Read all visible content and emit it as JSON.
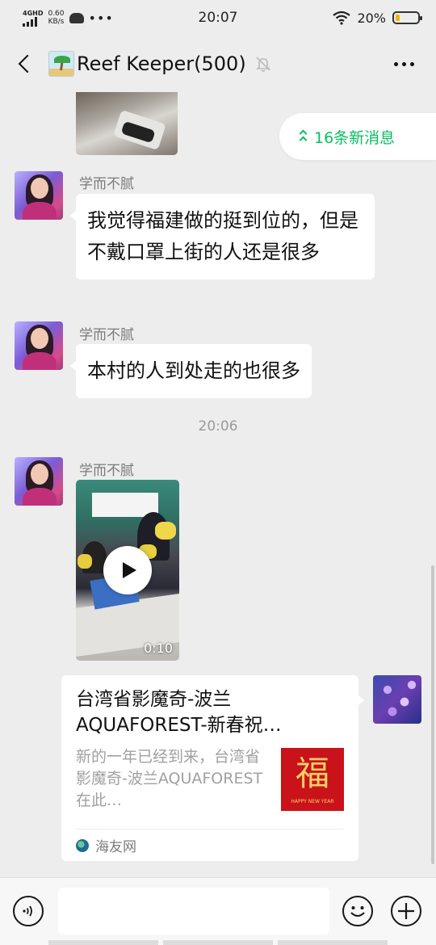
{
  "status_bar": {
    "network": "4GHD",
    "speed_value": "0.60",
    "speed_unit": "KB/s",
    "time": "20:07",
    "battery_percent": "20%",
    "battery_level": 0.2,
    "icons": [
      "signal-icon",
      "cloud-icon",
      "wifi-icon",
      "battery-icon"
    ]
  },
  "header": {
    "title": "Reef Keeper(500)",
    "icons": [
      "back-arrow-icon",
      "palm-island-icon",
      "muted-bell-icon",
      "more-dots-icon"
    ]
  },
  "new_messages": {
    "label": "16条新消息"
  },
  "messages": [
    {
      "type": "text",
      "sender": "学而不腻",
      "text": "我觉得福建做的挺到位的，但是不戴口罩上街的人还是很多"
    },
    {
      "type": "text",
      "sender": "学而不腻",
      "text": "本村的人到处走的也很多"
    },
    {
      "type": "time",
      "text": "20:06"
    },
    {
      "type": "video",
      "sender": "学而不腻",
      "duration": "0:10"
    },
    {
      "type": "link_card",
      "title": "台湾省影魔奇-波兰AQUAFOREST-新春祝…",
      "description": "新的一年已经到来，台湾省影魔奇-波兰AQUAFOREST在此…",
      "thumb_char": "福",
      "thumb_sub": "HAPPY NEW YEAR",
      "source": "海友网"
    }
  ],
  "colors": {
    "accent": "#07c160",
    "background": "#ededed",
    "bubble": "#ffffff"
  }
}
